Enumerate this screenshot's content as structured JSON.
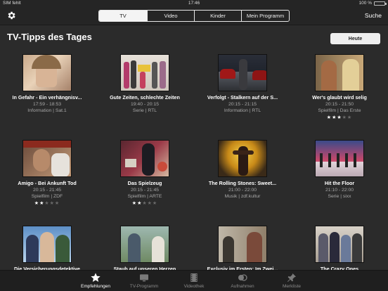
{
  "status": {
    "carrier": "SIM fehlt",
    "time": "17:46",
    "battery": "100 %"
  },
  "nav": {
    "tabs": [
      {
        "label": "TV",
        "active": true
      },
      {
        "label": "Video",
        "active": false
      },
      {
        "label": "Kinder",
        "active": false
      },
      {
        "label": "Mein Programm",
        "active": false
      }
    ],
    "search_label": "Suche",
    "settings_icon": "gear-icon"
  },
  "header": {
    "title": "TV-Tipps des Tages",
    "button": "Heute"
  },
  "cards": [
    {
      "title": "In Gefahr - Ein verhängnisv...",
      "time": "17:59 - 18:53",
      "meta": "Information | Sat.1",
      "rating": 0
    },
    {
      "title": "Gute Zeiten, schlechte Zeiten",
      "time": "19:40 - 20:15",
      "meta": "Serie | RTL",
      "rating": 0
    },
    {
      "title": "Verfolgt - Stalkern auf der S...",
      "time": "20:15 - 21:15",
      "meta": "Information | RTL",
      "rating": 0
    },
    {
      "title": "Wer's glaubt wird selig",
      "time": "20:15 - 21:50",
      "meta": "Spielfilm | Das Erste",
      "rating": 3
    },
    {
      "title": "Amigo - Bei Ankunft Tod",
      "time": "20:15 - 21:45",
      "meta": "Spielfilm | ZDF",
      "rating": 2
    },
    {
      "title": "Das Spielzeug",
      "time": "20:15 - 21:45",
      "meta": "Spielfilm | ARTE",
      "rating": 2
    },
    {
      "title": "The Rolling Stones: Sweet...",
      "time": "21:00 - 22:00",
      "meta": "Musik | zdf.kultur",
      "rating": 0
    },
    {
      "title": "Hit the Floor",
      "time": "21:10 - 22:00",
      "meta": "Serie | sixx",
      "rating": 0
    },
    {
      "title": "Die Versicherungsdetektive",
      "time": "",
      "meta": "",
      "rating": 0
    },
    {
      "title": "Staub auf unseren Herzen",
      "time": "",
      "meta": "",
      "rating": 0
    },
    {
      "title": "Exclusiv im Ersten: Im Zwei...",
      "time": "",
      "meta": "",
      "rating": 0
    },
    {
      "title": "The Crazy Ones",
      "time": "",
      "meta": "",
      "rating": 0
    }
  ],
  "tabbar": [
    {
      "label": "Empfehlungen",
      "icon": "star-icon",
      "active": true
    },
    {
      "label": "TV-Programm",
      "icon": "tv-icon",
      "active": false
    },
    {
      "label": "Videothek",
      "icon": "film-icon",
      "active": false
    },
    {
      "label": "Aufnahmen",
      "icon": "record-icon",
      "active": false
    },
    {
      "label": "Merkliste",
      "icon": "pin-icon",
      "active": false
    }
  ],
  "colors": {
    "background": "#2b2b2b",
    "bar": "#252525",
    "active_tab": "#ffffff",
    "inactive_tab": "#8a8a8a"
  }
}
